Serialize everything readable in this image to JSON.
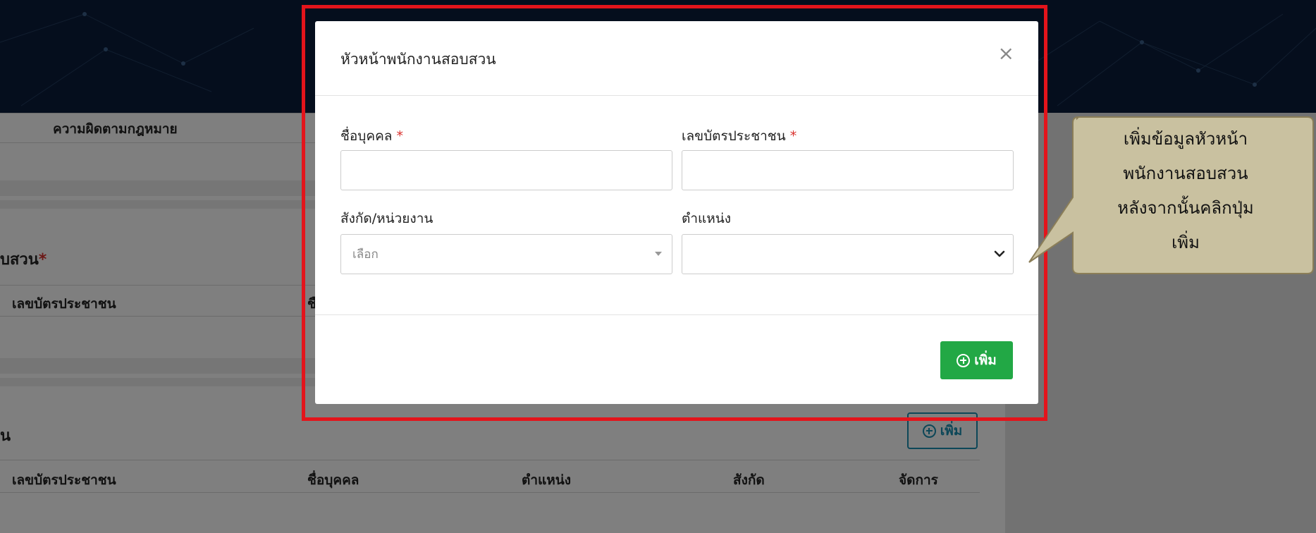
{
  "colors": {
    "header_bg": "#0b1d3a",
    "highlight_border": "#e3141b",
    "required_star": "#d9302c",
    "add_button_bg": "#22a845",
    "outline_button": "#1a8fb0",
    "callout_fill": "#c9c1a0",
    "callout_border": "#8b7e58"
  },
  "background": {
    "offense_col": "ความผิดตามกฎหมาย",
    "investigator_section": "บสวน",
    "required_mark": "*",
    "id_col_1": "เลขบัตรประชาชน",
    "partial_col_1": "ชื",
    "section_2": "น",
    "add_label": "เพิ่ม",
    "columns": [
      "เลขบัตรประชาชน",
      "ชื่อบุคคล",
      "ตำแหน่ง",
      "สังกัด",
      "จัดการ"
    ]
  },
  "modal": {
    "title": "หัวหน้าพนักงานสอบสวน",
    "close_symbol": "×",
    "name_label": "ชื่อบุคคล",
    "id_label": "เลขบัตรประชาชน",
    "required_mark": "*",
    "name_value": "",
    "id_value": "",
    "unit_label": "สังกัด/หน่วยงาน",
    "unit_placeholder": "เลือก",
    "position_label": "ตำแหน่ง",
    "position_value": "",
    "add_button_label": "เพิ่ม",
    "add_icon": "plus-circle-icon"
  },
  "callout": {
    "lines": [
      "เพิ่มข้อมูลหัวหน้า",
      "พนักงานสอบสวน",
      "หลังจากนั้นคลิกปุ่ม",
      "เพิ่ม"
    ]
  }
}
